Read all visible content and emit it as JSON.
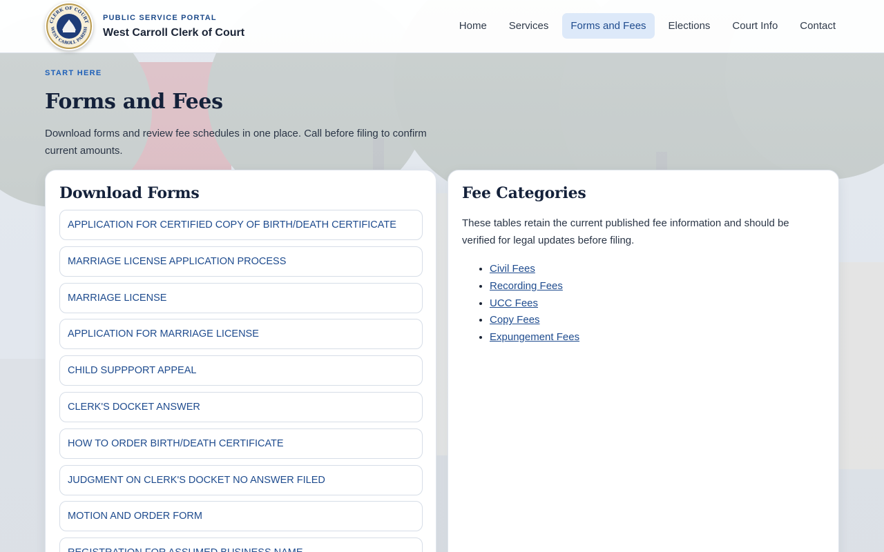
{
  "header": {
    "kicker": "PUBLIC SERVICE PORTAL",
    "site_name": "West Carroll Clerk of Court",
    "seal": {
      "top_text": "CLERK OF COURT",
      "bottom_text": "WEST CAROLL PARISH"
    },
    "nav": [
      {
        "label": "Home",
        "active": false
      },
      {
        "label": "Services",
        "active": false
      },
      {
        "label": "Forms and Fees",
        "active": true
      },
      {
        "label": "Elections",
        "active": false
      },
      {
        "label": "Court Info",
        "active": false
      },
      {
        "label": "Contact",
        "active": false
      }
    ]
  },
  "hero": {
    "eyebrow": "START HERE",
    "title": "Forms and Fees",
    "lead": "Download forms and review fee schedules in one place. Call before filing to confirm current amounts."
  },
  "forms": {
    "title": "Download Forms",
    "items": [
      "APPLICATION FOR CERTIFIED COPY OF BIRTH/DEATH CERTIFICATE",
      "MARRIAGE LICENSE APPLICATION PROCESS",
      "MARRIAGE LICENSE",
      "APPLICATION FOR MARRIAGE LICENSE",
      "CHILD SUPPPORT APPEAL",
      "CLERK'S DOCKET ANSWER",
      "HOW TO ORDER BIRTH/DEATH CERTIFICATE",
      "JUDGMENT ON CLERK'S DOCKET NO ANSWER FILED",
      "MOTION AND ORDER FORM",
      "REGISTRATION FOR ASSUMED BUSINESS NAME"
    ]
  },
  "fees": {
    "title": "Fee Categories",
    "description": "These tables retain the current published fee information and should be verified for legal updates before filing.",
    "items": [
      "Civil Fees",
      "Recording Fees",
      "UCC Fees",
      "Copy Fees",
      "Expungement Fees"
    ]
  },
  "colors": {
    "accent": "#1e4b8e",
    "nav_active_bg": "#dde9f9",
    "title": "#14213a"
  }
}
